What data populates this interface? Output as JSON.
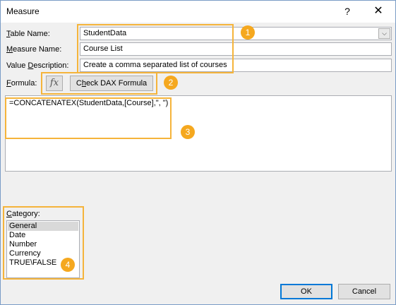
{
  "window": {
    "title": "Measure",
    "help_label": "?",
    "close_label": "✕"
  },
  "form": {
    "table_name": {
      "label_underlined": "T",
      "label_rest": "able Name:",
      "value": "StudentData"
    },
    "measure_name": {
      "label_underlined": "M",
      "label_rest": "easure Name:",
      "value": "Course List"
    },
    "value_description": {
      "label_before": "Value ",
      "label_underlined": "D",
      "label_rest": "escription:",
      "value": "Create a comma separated list of courses"
    },
    "formula": {
      "label_underlined": "F",
      "label_rest": "ormula:",
      "fx_label": "fx",
      "check_before": "C",
      "check_underlined": "h",
      "check_rest": "eck DAX Formula",
      "text": "=CONCATENATEX(StudentData,[Course],\", \")"
    }
  },
  "category": {
    "label_underlined": "C",
    "label_rest": "ategory:",
    "items": [
      "General",
      "Date",
      "Number",
      "Currency",
      "TRUE\\FALSE"
    ],
    "selected_index": 0
  },
  "buttons": {
    "ok": "OK",
    "cancel": "Cancel"
  },
  "annotations": {
    "badges": [
      "1",
      "2",
      "3",
      "4"
    ],
    "color": "#f5a81f"
  },
  "icons": {
    "combo": "chevron-down-icon",
    "fx": "function-icon",
    "close": "close-icon",
    "help": "help-icon"
  }
}
